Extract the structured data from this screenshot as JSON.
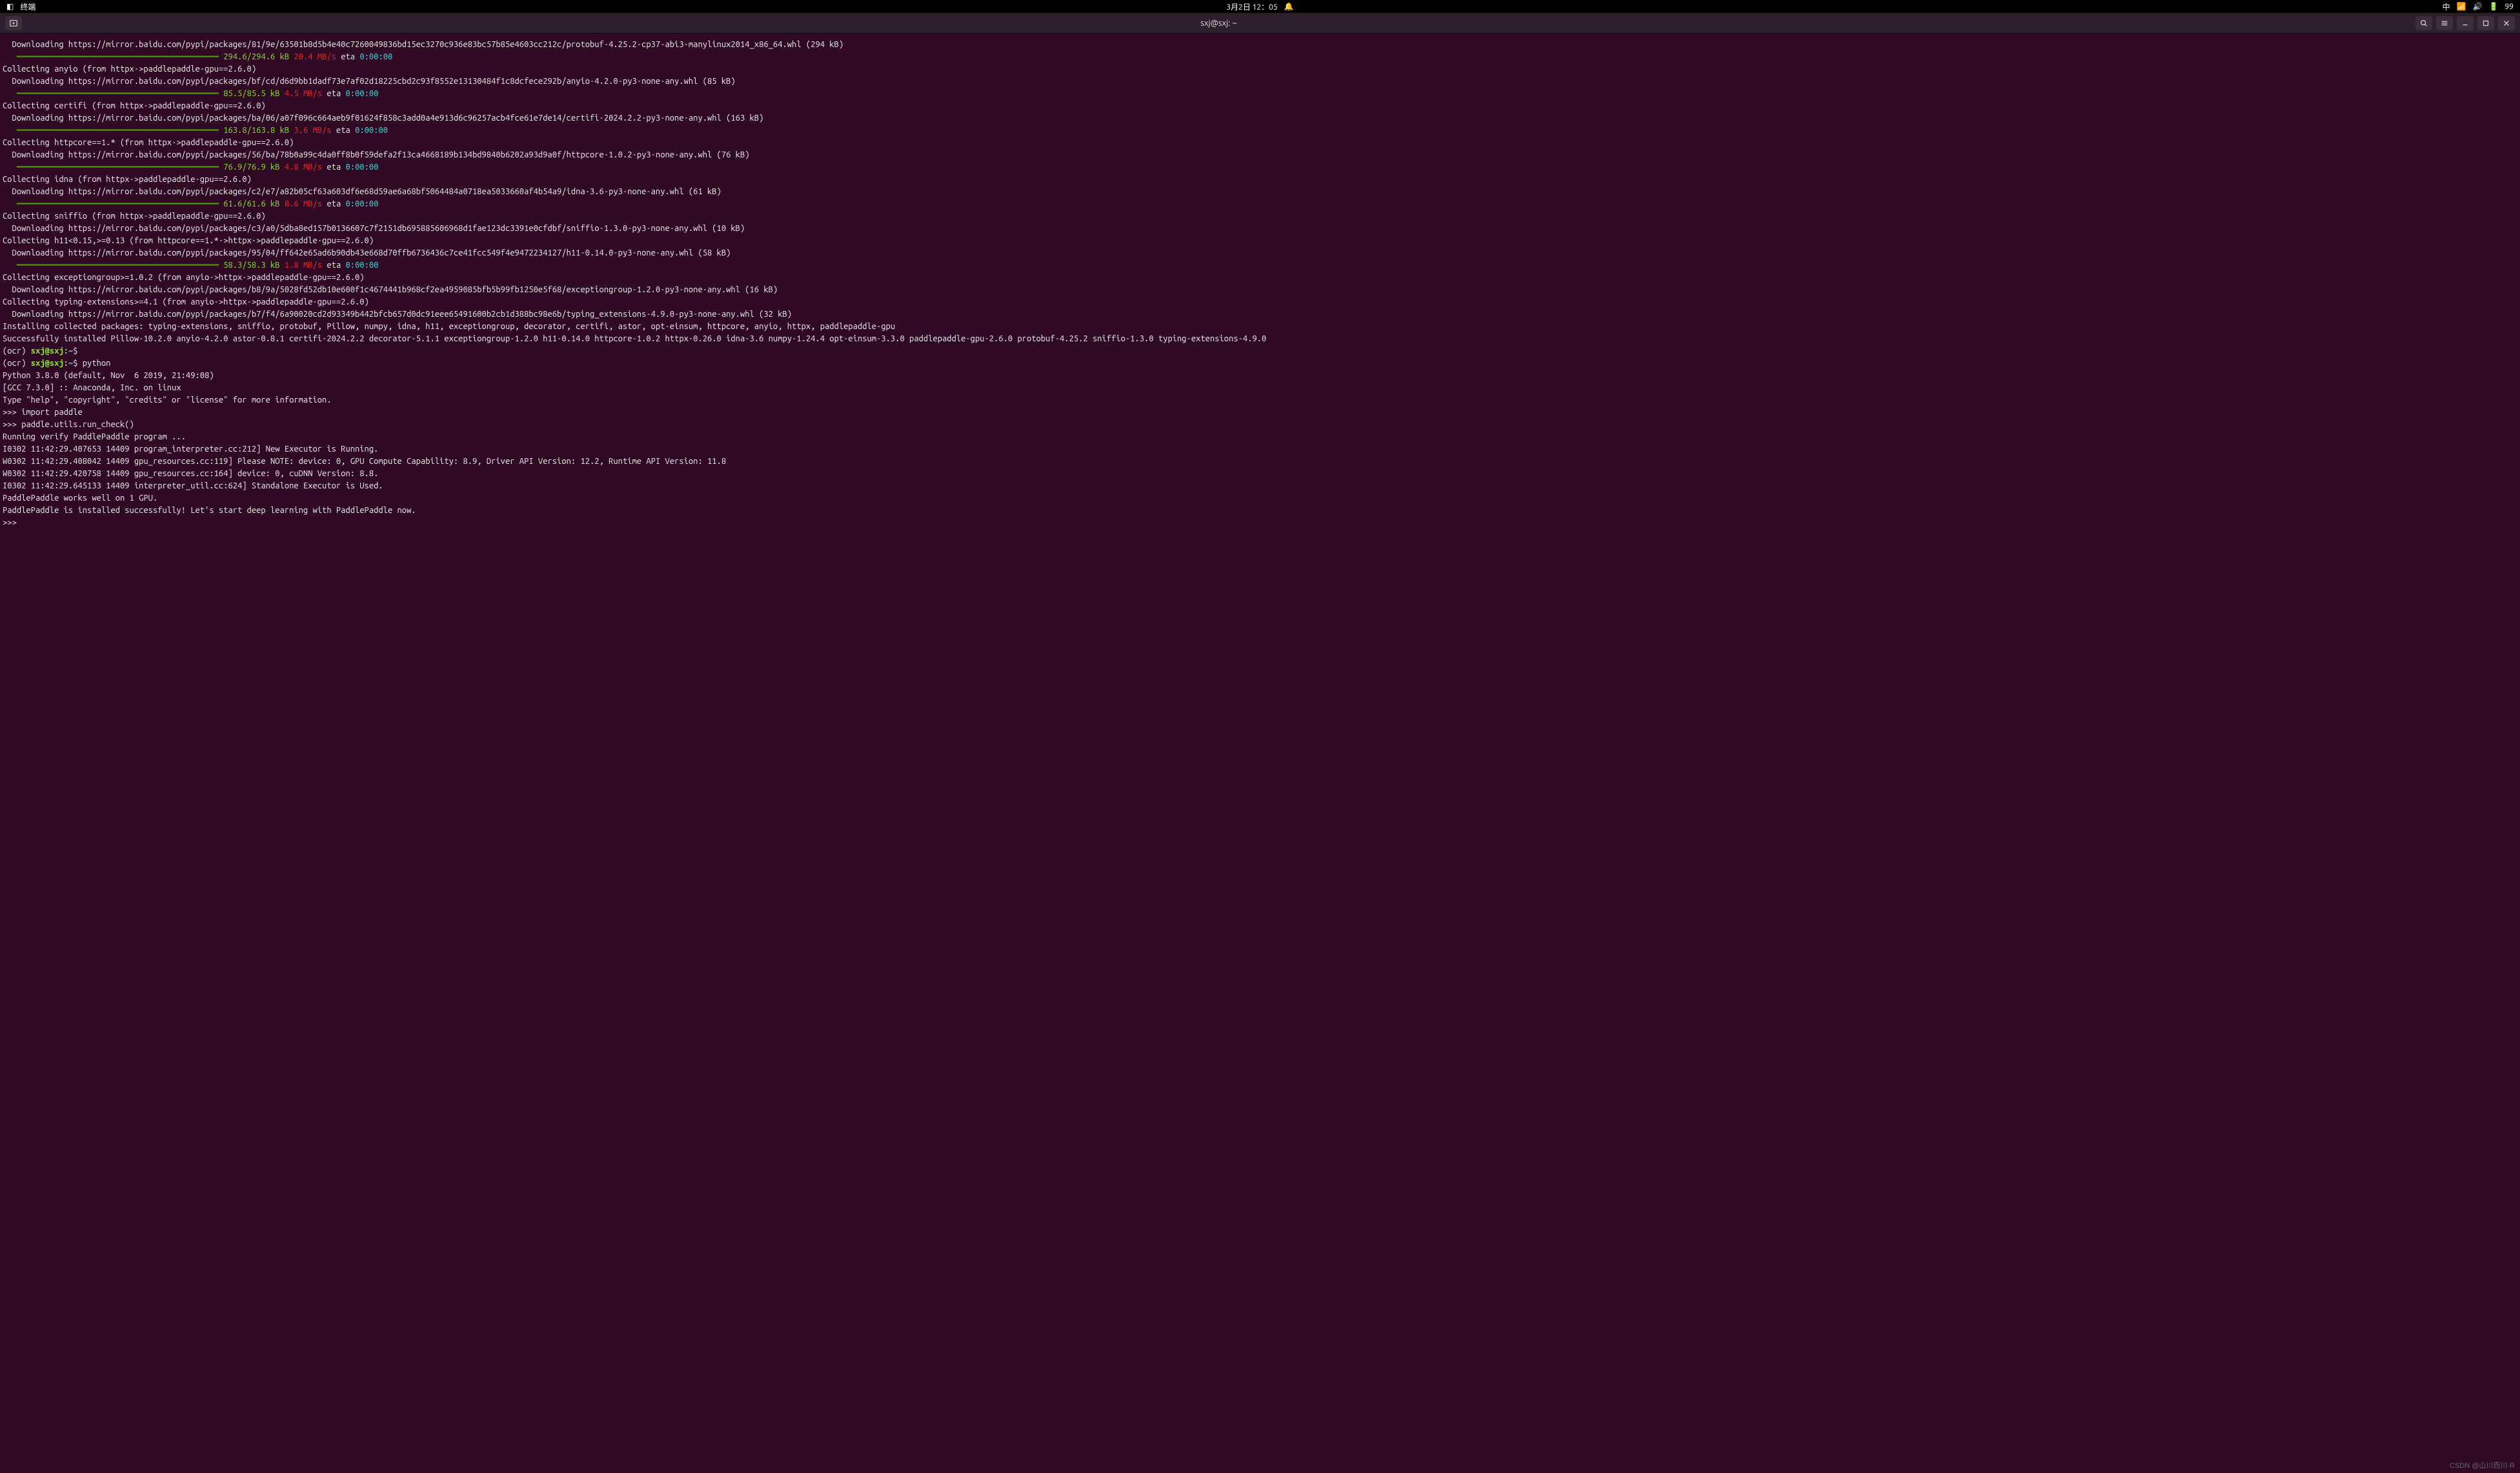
{
  "topbar": {
    "app_name": "终端",
    "datetime": "3月2日 12：05",
    "ime": "中",
    "battery": "99"
  },
  "titlebar": {
    "title": "sxj@sxj: ~"
  },
  "prompt": {
    "env": "(ocr) ",
    "user_host": "sxj@sxj",
    "sep": ":",
    "path": "~",
    "dollar": "$ ",
    "cmd_empty": "",
    "cmd_python": "python",
    "pyprompt": ">>> ",
    "py_import": "import paddle",
    "py_run_check": "paddle.utils.run_check()"
  },
  "downloads": [
    {
      "url": "  Downloading https://mirror.baidu.com/pypi/packages/81/9e/63501b8d5b4e40c7260049836bd15ec3270c936e83bc57b85e4603cc212c/protobuf-4.25.2-cp37-abi3-manylinux2014_x86_64.whl (294 kB)",
      "progress": {
        "size": "294.6/294.6 kB",
        "speed": "20.4 MB/s",
        "eta_label": " eta ",
        "eta": "0:00:00"
      }
    },
    {
      "collecting": "Collecting anyio (from httpx->paddlepaddle-gpu==2.6.0)",
      "url": "  Downloading https://mirror.baidu.com/pypi/packages/bf/cd/d6d9bb1dadf73e7af02d18225cbd2c93f8552e13130484f1c8dcfece292b/anyio-4.2.0-py3-none-any.whl (85 kB)",
      "progress": {
        "size": "85.5/85.5 kB",
        "speed": "4.5 MB/s",
        "eta_label": " eta ",
        "eta": "0:00:00"
      }
    },
    {
      "collecting": "Collecting certifi (from httpx->paddlepaddle-gpu==2.6.0)",
      "url": "  Downloading https://mirror.baidu.com/pypi/packages/ba/06/a07f096c664aeb9f01624f858c3add0a4e913d6c96257acb4fce61e7de14/certifi-2024.2.2-py3-none-any.whl (163 kB)",
      "progress": {
        "size": "163.8/163.8 kB",
        "speed": "3.6 MB/s",
        "eta_label": " eta ",
        "eta": "0:00:00"
      }
    },
    {
      "collecting": "Collecting httpcore==1.* (from httpx->paddlepaddle-gpu==2.6.0)",
      "url": "  Downloading https://mirror.baidu.com/pypi/packages/56/ba/78b0a99c4da0ff8b0f59defa2f13ca4668189b134bd9840b6202a93d9a0f/httpcore-1.0.2-py3-none-any.whl (76 kB)",
      "progress": {
        "size": "76.9/76.9 kB",
        "speed": "4.8 MB/s",
        "eta_label": " eta ",
        "eta": "0:00:00"
      }
    },
    {
      "collecting": "Collecting idna (from httpx->paddlepaddle-gpu==2.6.0)",
      "url": "  Downloading https://mirror.baidu.com/pypi/packages/c2/e7/a82b05cf63a603df6e68d59ae6a68bf5064484a0718ea5033660af4b54a9/idna-3.6-py3-none-any.whl (61 kB)",
      "progress": {
        "size": "61.6/61.6 kB",
        "speed": "8.6 MB/s",
        "eta_label": " eta ",
        "eta": "0:00:00"
      }
    },
    {
      "collecting": "Collecting sniffio (from httpx->paddlepaddle-gpu==2.6.0)",
      "url": "  Downloading https://mirror.baidu.com/pypi/packages/c3/a0/5dba8ed157b0136607c7f2151db695885606968d1fae123dc3391e0cfdbf/sniffio-1.3.0-py3-none-any.whl (10 kB)"
    },
    {
      "collecting": "Collecting h11<0.15,>=0.13 (from httpcore==1.*->httpx->paddlepaddle-gpu==2.6.0)",
      "url": "  Downloading https://mirror.baidu.com/pypi/packages/95/04/ff642e65ad6b90db43e668d70ffb6736436c7ce41fcc549f4e9472234127/h11-0.14.0-py3-none-any.whl (58 kB)",
      "progress": {
        "size": "58.3/58.3 kB",
        "speed": "1.8 MB/s",
        "eta_label": " eta ",
        "eta": "0:00:00"
      }
    },
    {
      "collecting": "Collecting exceptiongroup>=1.0.2 (from anyio->httpx->paddlepaddle-gpu==2.6.0)",
      "url": "  Downloading https://mirror.baidu.com/pypi/packages/b8/9a/5028fd52db10e600f1c4674441b968cf2ea4959085bfb5b99fb1250e5f68/exceptiongroup-1.2.0-py3-none-any.whl (16 kB)"
    },
    {
      "collecting": "Collecting typing-extensions>=4.1 (from anyio->httpx->paddlepaddle-gpu==2.6.0)",
      "url": "  Downloading https://mirror.baidu.com/pypi/packages/b7/f4/6a90020cd2d93349b442bfcb657d0dc91eee65491600b2cb1d388bc98e6b/typing_extensions-4.9.0-py3-none-any.whl (32 kB)"
    }
  ],
  "install": {
    "installing": "Installing collected packages: typing-extensions, sniffio, protobuf, Pillow, numpy, idna, h11, exceptiongroup, decorator, certifi, astor, opt-einsum, httpcore, anyio, httpx, paddlepaddle-gpu",
    "success": "Successfully installed Pillow-10.2.0 anyio-4.2.0 astor-0.8.1 certifi-2024.2.2 decorator-5.1.1 exceptiongroup-1.2.0 h11-0.14.0 httpcore-1.0.2 httpx-0.26.0 idna-3.6 numpy-1.24.4 opt-einsum-3.3.0 paddlepaddle-gpu-2.6.0 protobuf-4.25.2 sniffio-1.3.0 typing-extensions-4.9.0"
  },
  "python": {
    "banner1": "Python 3.8.0 (default, Nov  6 2019, 21:49:08) ",
    "banner2": "[GCC 7.3.0] :: Anaconda, Inc. on linux",
    "banner3": "Type \"help\", \"copyright\", \"credits\" or \"license\" for more information.",
    "out1": "Running verify PaddlePaddle program ... ",
    "out2": "I0302 11:42:29.407653 14409 program_interpreter.cc:212] New Executor is Running.",
    "out3": "W0302 11:42:29.408042 14409 gpu_resources.cc:119] Please NOTE: device: 0, GPU Compute Capability: 8.9, Driver API Version: 12.2, Runtime API Version: 11.8",
    "out4": "W0302 11:42:29.420758 14409 gpu_resources.cc:164] device: 0, cuDNN Version: 8.8.",
    "out5": "I0302 11:42:29.645133 14409 interpreter_util.cc:624] Standalone Executor is Used.",
    "out6": "PaddlePaddle works well on 1 GPU.",
    "out7": "PaddlePaddle is installed successfully! Let's start deep learning with PaddlePaddle now."
  },
  "watermark": "CSDN @山川而川-R"
}
